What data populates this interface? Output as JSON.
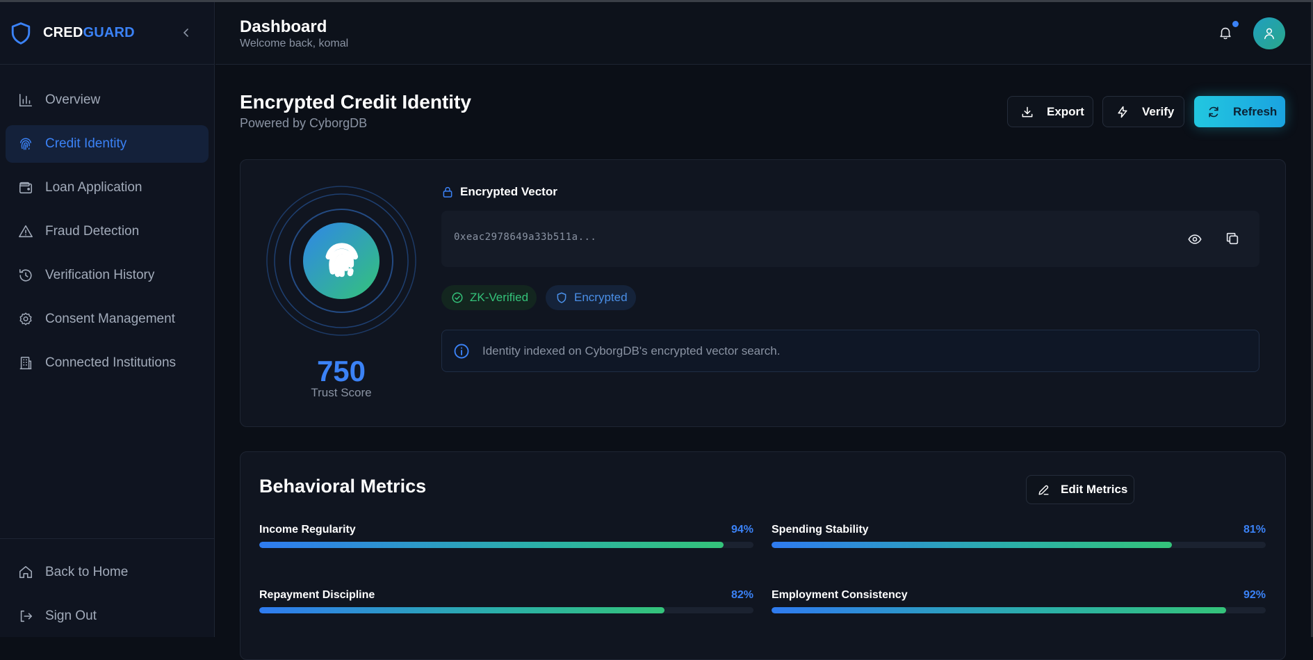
{
  "brand": {
    "part1": "CRED",
    "part2": "GUARD"
  },
  "sidebar": {
    "items": [
      {
        "label": "Overview",
        "icon": "bar-chart-icon"
      },
      {
        "label": "Credit Identity",
        "icon": "fingerprint-icon",
        "active": true
      },
      {
        "label": "Loan Application",
        "icon": "wallet-icon"
      },
      {
        "label": "Fraud Detection",
        "icon": "alert-triangle-icon"
      },
      {
        "label": "Verification History",
        "icon": "history-icon"
      },
      {
        "label": "Consent Management",
        "icon": "gear-icon"
      },
      {
        "label": "Connected Institutions",
        "icon": "building-icon"
      }
    ],
    "bottom": [
      {
        "label": "Back to Home",
        "icon": "home-icon"
      },
      {
        "label": "Sign Out",
        "icon": "sign-out-icon"
      }
    ]
  },
  "header": {
    "title": "Dashboard",
    "subtitle": "Welcome back, komal"
  },
  "main": {
    "title": "Encrypted Credit Identity",
    "subtitle": "Powered by CyborgDB",
    "actions": {
      "export": "Export",
      "verify": "Verify",
      "refresh": "Refresh"
    },
    "identity": {
      "score": "750",
      "score_label": "Trust Score",
      "vector_label": "Encrypted Vector",
      "vector_value": "0xeac2978649a33b511a...",
      "badges": {
        "zk": "ZK-Verified",
        "encrypted": "Encrypted"
      },
      "info": "Identity indexed on CyborgDB's encrypted vector search."
    },
    "metrics": {
      "title": "Behavioral Metrics",
      "edit_label": "Edit Metrics",
      "items": [
        {
          "name": "Income Regularity",
          "pct_label": "94%",
          "value": 94
        },
        {
          "name": "Spending Stability",
          "pct_label": "81%",
          "value": 81
        },
        {
          "name": "Repayment Discipline",
          "pct_label": "82%",
          "value": 82
        },
        {
          "name": "Employment Consistency",
          "pct_label": "92%",
          "value": 92
        }
      ]
    }
  },
  "colors": {
    "accent": "#3b82f6",
    "success": "#34c37a",
    "refresh": "#22c7e0",
    "background": "#0b0f17"
  }
}
